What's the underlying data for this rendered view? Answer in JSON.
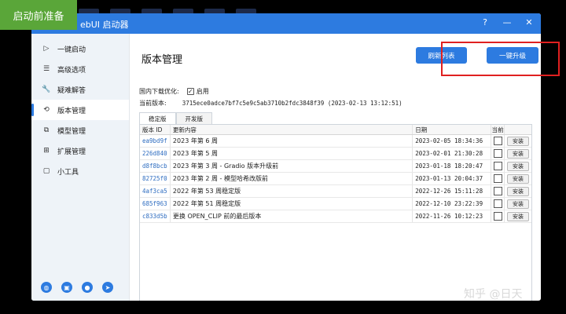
{
  "overlay": {
    "badge": "启动前准备",
    "watermark": "知乎 @日天"
  },
  "window": {
    "title": "ebUI 启动器",
    "help": "?",
    "minimize": "—",
    "close": "✕"
  },
  "sidebar": {
    "items": [
      {
        "label": "一键启动",
        "icon": "▷"
      },
      {
        "label": "高级选项",
        "icon": "☰"
      },
      {
        "label": "疑难解答",
        "icon": "🔧"
      },
      {
        "label": "版本管理",
        "icon": "⟲"
      },
      {
        "label": "模型管理",
        "icon": "⧉"
      },
      {
        "label": "扩展管理",
        "icon": "⊞"
      },
      {
        "label": "小工具",
        "icon": "▢"
      }
    ],
    "active_index": 3,
    "bottom_icons": [
      "globe-icon",
      "bilibili-icon",
      "qq-icon",
      "telegram-icon"
    ]
  },
  "main": {
    "title": "版本管理",
    "refresh_button": "刷新列表",
    "upgrade_button": "一键升级",
    "domestic_label": "国内下载优化:",
    "domestic_checkbox_label": "启用",
    "domestic_checked": true,
    "current_version_label": "当前版本:",
    "current_version_value": "3715ece0adce7bf7c5e9c5ab3710b2fdc3848f39 (2023-02-13 13:12:51)",
    "tabs": [
      "稳定版",
      "开发版"
    ],
    "active_tab": 0,
    "table": {
      "headers": [
        "版本 ID",
        "更新内容",
        "日期",
        "当前",
        ""
      ],
      "rows": [
        {
          "id": "ea9bd9f",
          "desc": "2023 年第 6 周",
          "date": "2023-02-05 18:34:36",
          "action": "安装"
        },
        {
          "id": "226d840",
          "desc": "2023 年第 5 周",
          "date": "2023-02-01 21:30:28",
          "action": "安装"
        },
        {
          "id": "d8f8bcb",
          "desc": "2023 年第 3 周 - Gradio 版本升级前",
          "date": "2023-01-18 18:20:47",
          "action": "安装"
        },
        {
          "id": "82725f0",
          "desc": "2023 年第 2 周 - 模型哈希改版前",
          "date": "2023-01-13 20:04:37",
          "action": "安装"
        },
        {
          "id": "4af3ca5",
          "desc": "2022 年第 53 周稳定版",
          "date": "2022-12-26 15:11:28",
          "action": "安装"
        },
        {
          "id": "685f963",
          "desc": "2022 年第 51 周稳定版",
          "date": "2022-12-10 23:22:39",
          "action": "安装"
        },
        {
          "id": "c833d5b",
          "desc": "更换 OPEN_CLIP 前的最后版本",
          "date": "2022-11-26 10:12:23",
          "action": "安装"
        }
      ]
    }
  }
}
